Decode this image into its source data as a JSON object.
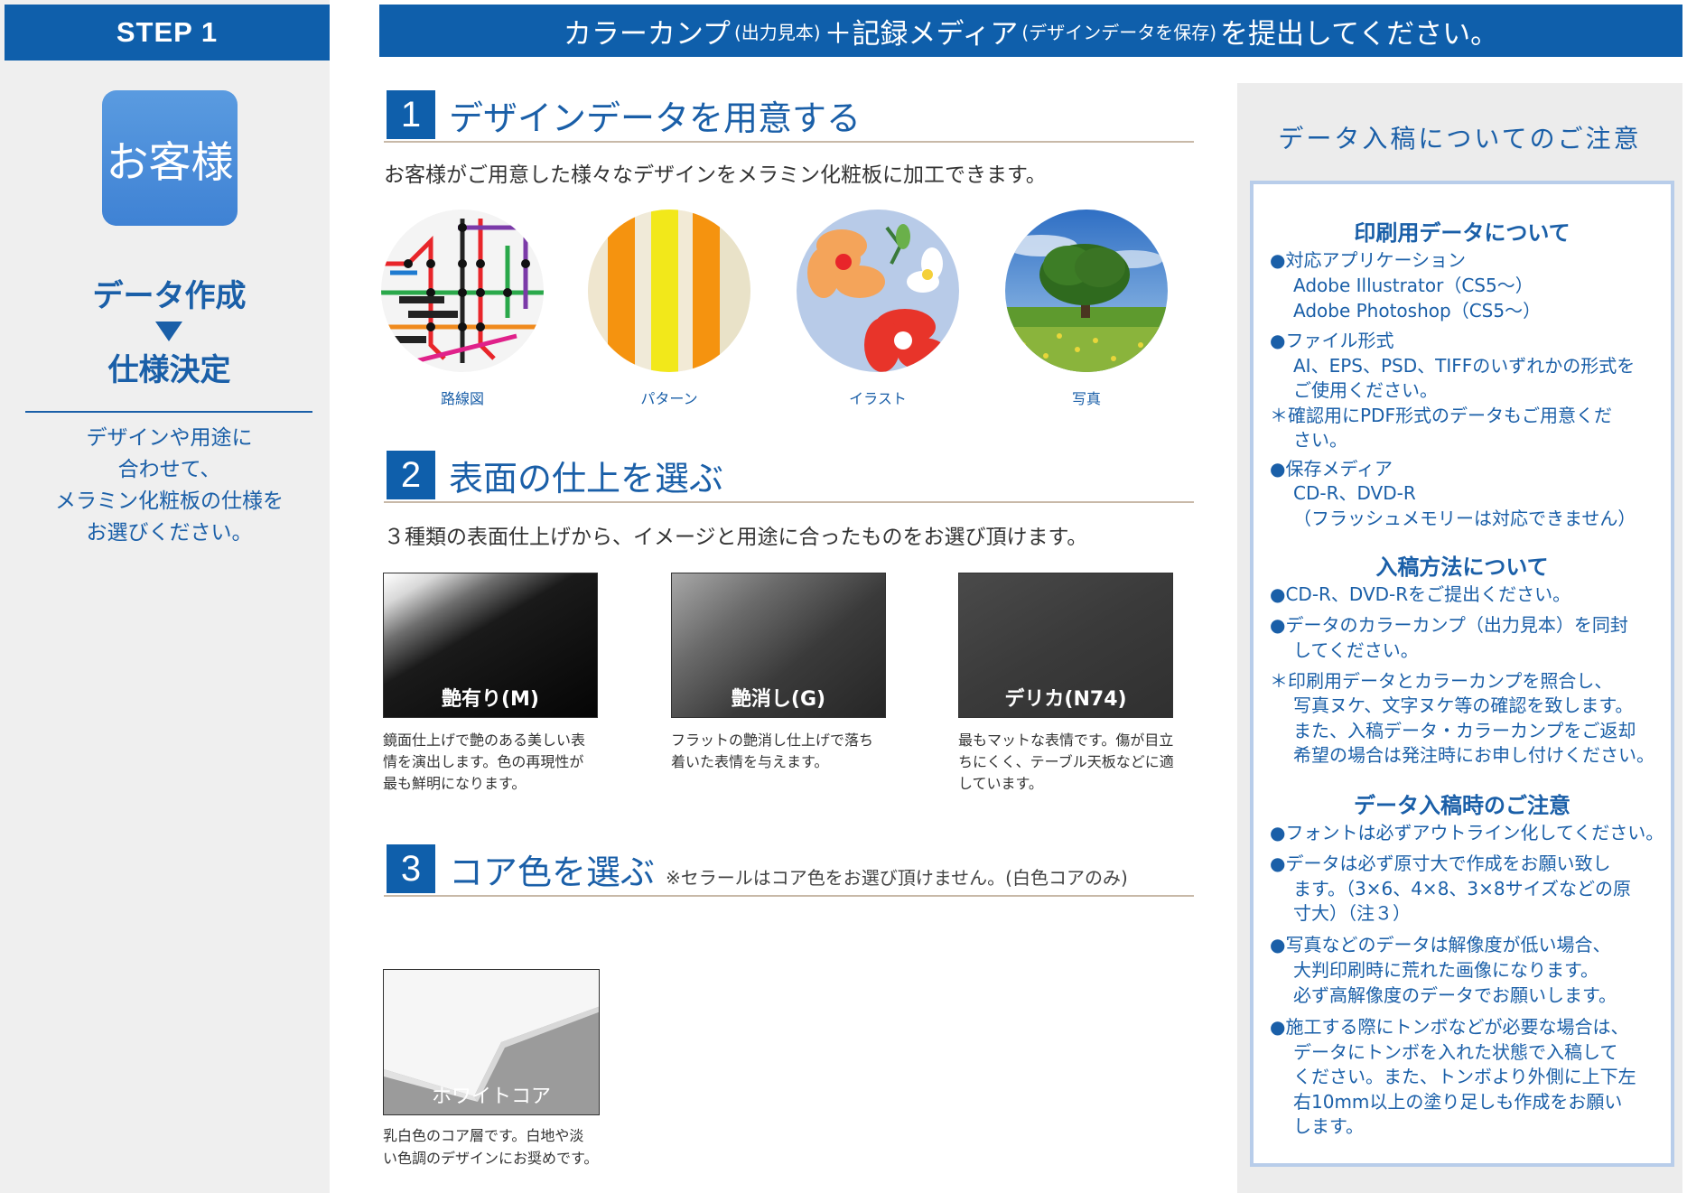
{
  "left": {
    "step_label": "STEP 1",
    "customer": "お客様",
    "flow_1": "データ作成",
    "flow_2": "仕様決定",
    "description": "デザインや用途に\n合わせて、\nメラミン化粧板の仕様を\nお選びください。"
  },
  "top_bar": {
    "part1": "カラーカンプ",
    "part1_small": "(出力見本)",
    "plus": "＋",
    "part2": "記録メディア",
    "part2_small": "(デザインデータを保存)",
    "part3": "を提出してください。"
  },
  "section1": {
    "number": "1",
    "title": "デザインデータを用意する",
    "text": "お客様がご用意した様々なデザインをメラミン化粧板に加工できます。",
    "items": [
      {
        "label": "路線図",
        "icon": "route-map-image"
      },
      {
        "label": "パターン",
        "icon": "stripe-pattern-image"
      },
      {
        "label": "イラスト",
        "icon": "flower-illustration-image"
      },
      {
        "label": "写真",
        "icon": "tree-photo-image"
      }
    ]
  },
  "section2": {
    "number": "2",
    "title": "表面の仕上を選ぶ",
    "text": "３種類の表面仕上げから、イメージと用途に合ったものをお選び頂けます。",
    "finishes": [
      {
        "label": "艶有り(M)",
        "desc": "鏡面仕上げで艶のある美しい表\n情を演出します。色の再現性が\n最も鮮明になります。"
      },
      {
        "label": "艶消し(G)",
        "desc": "フラットの艶消し仕上げで落ち\n着いた表情を与えます。"
      },
      {
        "label": "デリカ(N74)",
        "desc": "最もマットな表情です。傷が目立\nちにくく、テーブル天板などに適\nしています。"
      }
    ]
  },
  "section3": {
    "number": "3",
    "title": "コア色を選ぶ",
    "note": "※セラールはコア色をお選び頂けません。(白色コアのみ)",
    "core_label": "ホワイトコア",
    "core_desc": "乳白色のコア層です。白地や淡\nい色調のデザインにお奨めです。"
  },
  "right": {
    "title": "データ入稿についてのご注意",
    "heading1": "印刷用データについて",
    "h1_l1": "●対応アプリケーション",
    "h1_l2": "Adobe Illustrator（CS5〜）",
    "h1_l3": "Adobe Photoshop（CS5〜）",
    "h1_l4": "●ファイル形式",
    "h1_l5": "AI、EPS、PSD、TIFFのいずれかの形式を",
    "h1_l6": "ご使用ください。",
    "h1_l7": "＊確認用にPDF形式のデータもご用意くだ",
    "h1_l8": "さい。",
    "h1_l9": "●保存メディア",
    "h1_l10": "CD-R、DVD-R",
    "h1_l11": "（フラッシュメモリーは対応できません）",
    "heading2": "入稿方法について",
    "h2_l1": "●CD-R、DVD-Rをご提出ください。",
    "h2_l2": "●データのカラーカンプ（出力見本）を同封",
    "h2_l3": "してください。",
    "h2_l4": "＊印刷用データとカラーカンプを照合し、",
    "h2_l5": "写真ヌケ、文字ヌケ等の確認を致します。",
    "h2_l6": "また、入稿データ・カラーカンプをご返却",
    "h2_l7": "希望の場合は発注時にお申し付けください。",
    "heading3": "データ入稿時のご注意",
    "h3_l1": "●フォントは必ずアウトライン化してください。",
    "h3_l2": "●データは必ず原寸大で作成をお願い致し",
    "h3_l3": "ます。（3×6、4×8、3×8サイズなどの原",
    "h3_l4": "寸大）（注３）",
    "h3_l5": "●写真などのデータは解像度が低い場合、",
    "h3_l6": "大判印刷時に荒れた画像になります。",
    "h3_l7": "必ず高解像度のデータでお願いします。",
    "h3_l8": "●施工する際にトンボなどが必要な場合は、",
    "h3_l9": "データにトンボを入れた状態で入稿して",
    "h3_l10": "ください。また、トンボより外側に上下左",
    "h3_l11": "右10mm以上の塗り足しも作成をお願い",
    "h3_l12": "します。"
  },
  "colors": {
    "brand_blue": "#0f5fab",
    "text_blue": "#1a5fa8",
    "box_blue": "#4a8cda",
    "right_panel": "#ececec",
    "note_border": "#b8cdea"
  }
}
